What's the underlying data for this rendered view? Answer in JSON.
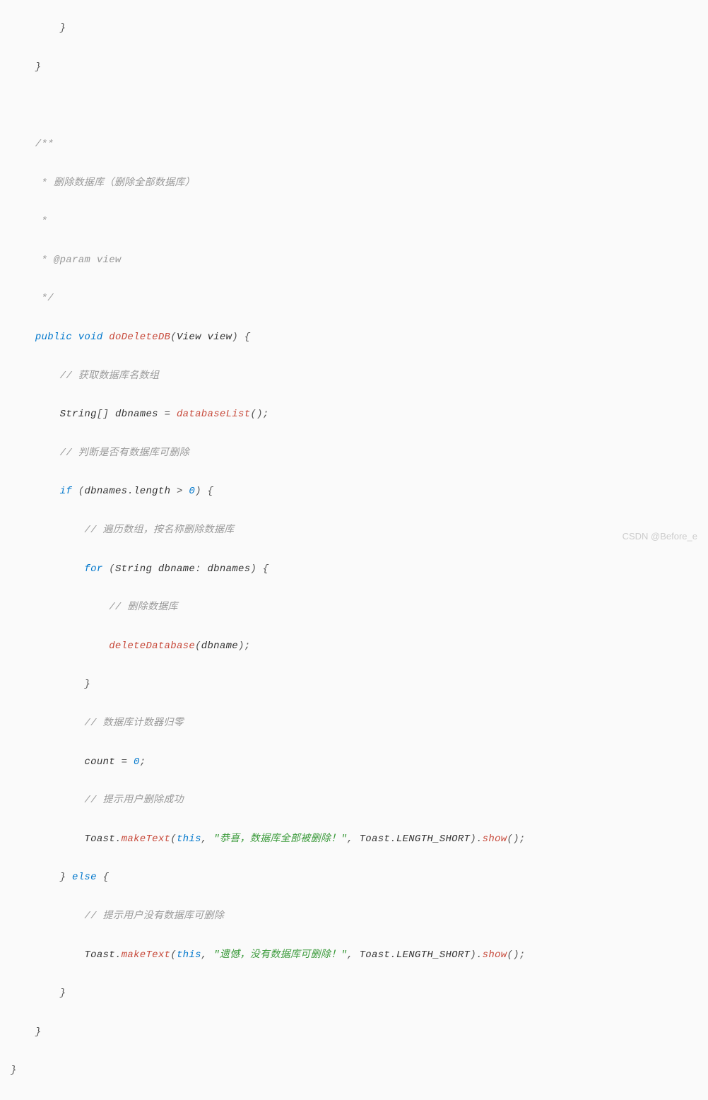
{
  "code": {
    "l0": "        }",
    "l1": "    }",
    "l2": " ",
    "l3": "    /**",
    "l4": "     * 删除数据库（删除全部数据库）",
    "l5": "     *",
    "l6": "     * @param view",
    "l7": "     */",
    "kw_public": "public",
    "kw_void": "void",
    "m_doDeleteDB": "doDeleteDB",
    "p_View": "View",
    "p_view": "view",
    "c9": "// 获取数据库名数组",
    "t_String": "String",
    "v_dbnames": "dbnames",
    "m_databaseList": "databaseList",
    "c11": "// 判断是否有数据库可删除",
    "kw_if": "if",
    "v_length": "length",
    "n0": "0",
    "c13": "// 遍历数组，按名称删除数据库",
    "kw_for": "for",
    "v_dbname": "dbname",
    "c15": "// 删除数据库",
    "m_deleteDatabase": "deleteDatabase",
    "c18": "// 数据库计数器归零",
    "v_count": "count",
    "c20": "// 提示用户删除成功",
    "t_Toast": "Toast",
    "m_makeText": "makeText",
    "kw_this": "this",
    "s1": "\"恭喜，数据库全部被删除！\"",
    "e_LENGTH_SHORT": "LENGTH_SHORT",
    "m_show": "show",
    "kw_else": "else",
    "c23": "// 提示用户没有数据库可删除",
    "s2": "\"遗憾，没有数据库可删除！\"",
    "cbr1": "        }",
    "cbr2": "    }",
    "cbr3": "}",
    "cbr4": "            }",
    "cbr5": "        } ",
    "op_eq": " = ",
    "op_gt": " > ",
    "op_dot": ".",
    "op_comma": ", ",
    "op_colon": ": ",
    "op_lp": "(",
    "op_rp": ")",
    "op_lb": "[]",
    "op_semi": ";",
    "op_lbr": " {",
    "sp": " "
  },
  "watermark": "CSDN @Before_e"
}
